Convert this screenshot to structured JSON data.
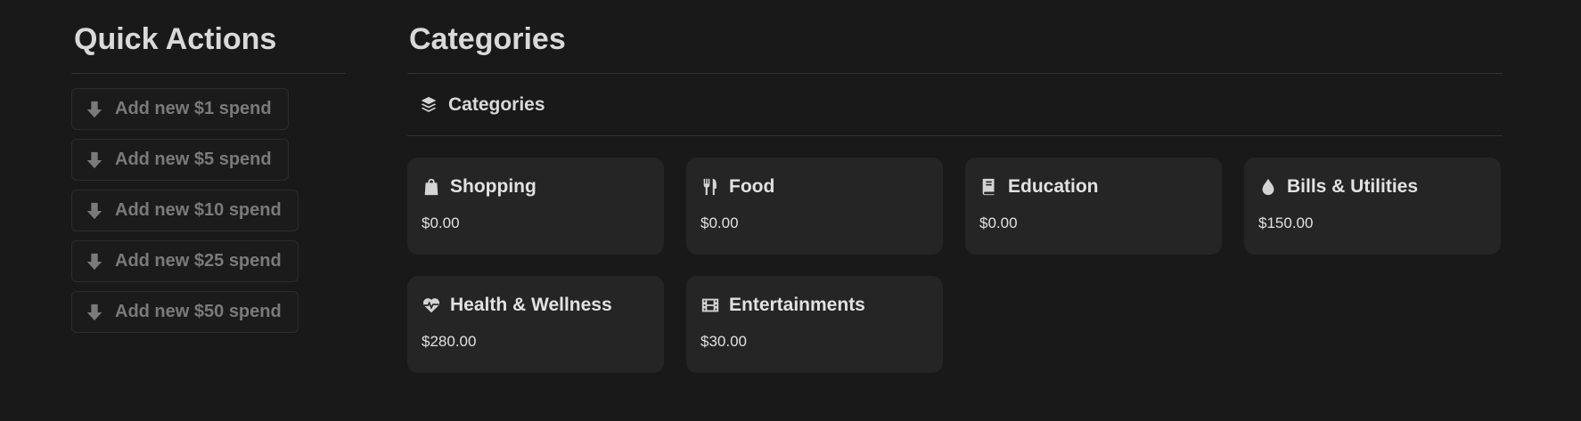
{
  "quick_actions": {
    "title": "Quick Actions",
    "buttons": [
      {
        "label": "Add new $1 spend",
        "icon": "arrow-down-icon"
      },
      {
        "label": "Add new $5 spend",
        "icon": "arrow-down-icon"
      },
      {
        "label": "Add new $10 spend",
        "icon": "arrow-down-icon"
      },
      {
        "label": "Add new $25 spend",
        "icon": "arrow-down-icon"
      },
      {
        "label": "Add new $50 spend",
        "icon": "arrow-down-icon"
      }
    ]
  },
  "categories": {
    "title": "Categories",
    "view_label": "Categories",
    "view_icon": "layers-icon",
    "cards": [
      {
        "name": "Shopping",
        "amount": "$0.00",
        "icon": "shopping-bag-icon"
      },
      {
        "name": "Food",
        "amount": "$0.00",
        "icon": "utensils-icon"
      },
      {
        "name": "Education",
        "amount": "$0.00",
        "icon": "book-icon"
      },
      {
        "name": "Bills & Utilities",
        "amount": "$150.00",
        "icon": "water-drop-icon"
      },
      {
        "name": "Health & Wellness",
        "amount": "$280.00",
        "icon": "heart-pulse-icon"
      },
      {
        "name": "Entertainments",
        "amount": "$30.00",
        "icon": "film-icon"
      }
    ]
  },
  "colors": {
    "background": "#191919",
    "card": "#252525",
    "muted_text": "#7a7a7a",
    "text": "#e2e2e2"
  }
}
